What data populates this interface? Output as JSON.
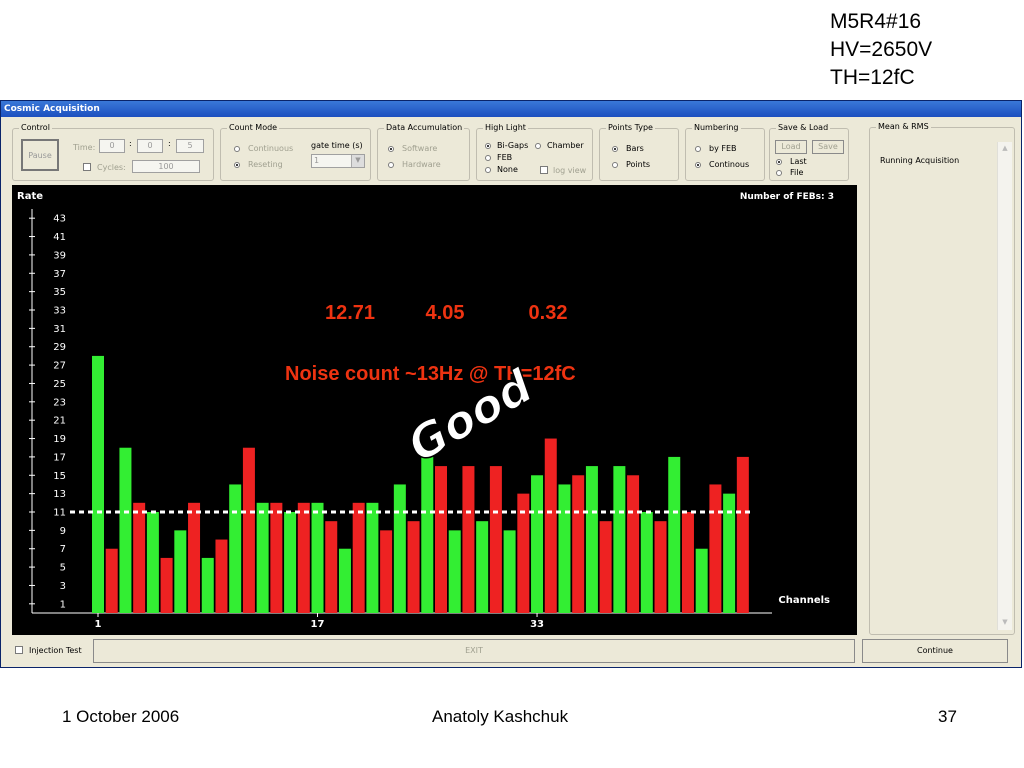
{
  "slide": {
    "top_note": [
      "M5R4#16",
      "HV=2650V",
      "TH=12fC"
    ],
    "footer_date": "1 October 2006",
    "footer_author": "Anatoly Kashchuk",
    "footer_page": "37"
  },
  "window": {
    "title": "Cosmic Acquisition"
  },
  "control": {
    "title": "Control",
    "pause_label": "Pause",
    "time_label": "Time:",
    "time_values": [
      "0",
      "0",
      "5"
    ],
    "time_sep": ":",
    "cycles_label": "Cycles:",
    "cycles_value": "100"
  },
  "count_mode": {
    "title": "Count Mode",
    "continuous_label": "Continuous",
    "reseting_label": "Reseting",
    "gate_time_label": "gate time (s)",
    "gate_time_value": "1"
  },
  "data_accumulation": {
    "title": "Data Accumulation",
    "software_label": "Software",
    "hardware_label": "Hardware"
  },
  "high_light": {
    "title": "High Light",
    "bigaps_label": "Bi-Gaps",
    "chamber_label": "Chamber",
    "feb_label": "FEB",
    "none_label": "None",
    "logview_label": "log view"
  },
  "points_type": {
    "title": "Points Type",
    "bars_label": "Bars",
    "points_label": "Points"
  },
  "numbering": {
    "title": "Numbering",
    "byfeb_label": "by FEB",
    "continous_label": "Continous"
  },
  "save_load": {
    "title": "Save & Load",
    "load_label": "Load",
    "save_label": "Save",
    "last_label": "Last",
    "file_label": "File"
  },
  "mean_rms": {
    "title": "Mean & RMS",
    "text": "Running Acquisition"
  },
  "bottom": {
    "injection_label": "Injection Test",
    "exit_label": "EXIT",
    "continue_label": "Continue"
  },
  "overlay": {
    "stats": [
      "12.71",
      "4.05",
      "0.32"
    ],
    "noise_text": "Noise count ~13Hz @ TH=12fC",
    "good_text": "Good"
  },
  "colors": {
    "green": "#33ee33",
    "red": "#ee2222",
    "overlay_red": "#ee3311",
    "plot_bg": "#000000"
  },
  "chart_data": {
    "type": "bar",
    "title": "",
    "ylabel": "Rate",
    "xlabel": "Channels",
    "info_text": "Number of FEBs:  3",
    "y_tick_labels": [
      1,
      3,
      5,
      7,
      9,
      11,
      13,
      15,
      17,
      19,
      21,
      23,
      25,
      27,
      29,
      31,
      33,
      35,
      37,
      39,
      41,
      43
    ],
    "ylim": [
      0,
      44
    ],
    "x_tick_labels": [
      "1",
      "17",
      "33"
    ],
    "x": [
      1,
      2,
      3,
      4,
      5,
      6,
      7,
      8,
      9,
      10,
      11,
      12,
      13,
      14,
      15,
      16,
      17,
      18,
      19,
      20,
      21,
      22,
      23,
      24,
      25,
      26,
      27,
      28,
      29,
      30,
      31,
      32,
      33,
      34,
      35,
      36,
      37,
      38,
      39,
      40,
      41,
      42,
      43,
      44,
      45,
      46,
      47,
      48
    ],
    "values": [
      28,
      7,
      18,
      12,
      11,
      6,
      9,
      12,
      6,
      8,
      14,
      18,
      12,
      12,
      11,
      12,
      12,
      10,
      7,
      12,
      12,
      9,
      14,
      10,
      17,
      16,
      9,
      16,
      10,
      16,
      9,
      13,
      15,
      19,
      14,
      15,
      16,
      10,
      16,
      15,
      11,
      10,
      17,
      11,
      7,
      14,
      13,
      17
    ],
    "bar_colors": [
      "green",
      "red",
      "green",
      "red",
      "green",
      "red",
      "green",
      "red",
      "green",
      "red",
      "green",
      "red",
      "green",
      "red",
      "green",
      "red",
      "green",
      "red",
      "green",
      "red",
      "green",
      "red",
      "green",
      "red",
      "green",
      "red",
      "green",
      "red",
      "green",
      "red",
      "green",
      "red",
      "green",
      "red",
      "green",
      "red",
      "green",
      "red",
      "green",
      "red",
      "green",
      "red",
      "green",
      "red",
      "green",
      "red",
      "green",
      "red"
    ],
    "mean_line": 11,
    "grid": false
  }
}
